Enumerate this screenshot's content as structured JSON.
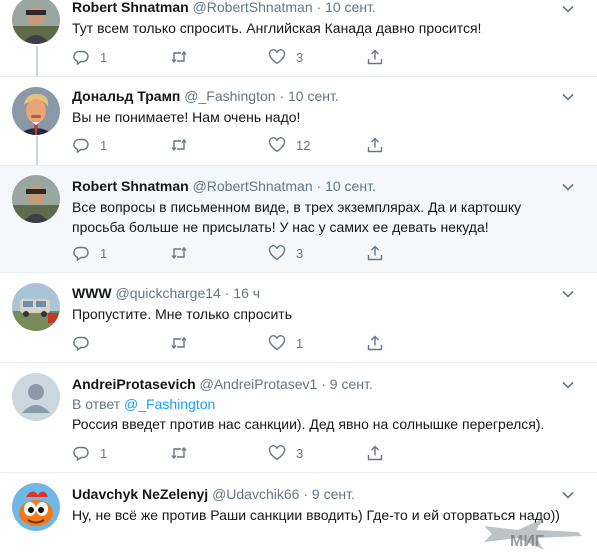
{
  "tweets": [
    {
      "name": "Robert Shnatman",
      "handle": "@RobertShnatman",
      "time": "10 сент.",
      "text": "Тут всем только спросить. Английская Канада давно просится!",
      "replies": "1",
      "retweets": "",
      "likes": "3"
    },
    {
      "name": "Дональд Трамп",
      "handle": "@_Fashington",
      "time": "10 сент.",
      "text": "Вы не понимаете! Нам очень надо!",
      "replies": "1",
      "retweets": "",
      "likes": "12"
    },
    {
      "name": "Robert Shnatman",
      "handle": "@RobertShnatman",
      "time": "10 сент.",
      "text": "Все вопросы в письменном виде, в трех экземплярах. Да и картошку просьба больше не присылать! У нас у самих ее девать некуда!",
      "replies": "1",
      "retweets": "",
      "likes": "3"
    },
    {
      "name": "WWW",
      "handle": "@quickcharge14",
      "time": "16 ч",
      "text": "Пропустите. Мне только спросить",
      "replies": "",
      "retweets": "",
      "likes": "1"
    },
    {
      "name": "AndreiProtasevich",
      "handle": "@AndreiProtasev1",
      "time": "9 сент.",
      "reply_prefix": "В ответ",
      "reply_mention": "@_Fashington",
      "text": "Россия введет против нас санкции). Дед явно на солнышке перегрелся).",
      "replies": "1",
      "retweets": "",
      "likes": "3"
    },
    {
      "name": "Udavchyk NeZelenyj",
      "handle": "@Udavchik66",
      "time": "9 сент.",
      "text": "Ну, не всё же против Раши санкции вводить) Где-то и ей оторваться надо))"
    }
  ],
  "dot": "·",
  "watermark": "МИГ",
  "colors": {
    "accent": "#1da1f2",
    "secondary_text": "#657786",
    "highlight_bg": "#f5f8fa",
    "divider": "#e6ecf0"
  },
  "icons": [
    "reply-icon",
    "retweet-icon",
    "like-icon",
    "share-icon",
    "chevron-down-icon"
  ]
}
